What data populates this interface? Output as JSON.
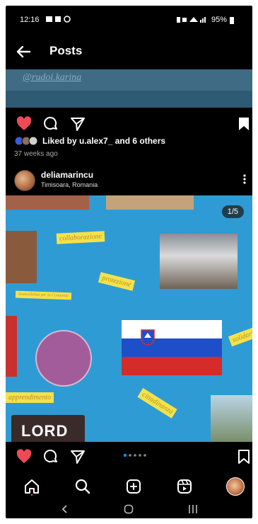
{
  "status_bar": {
    "time": "12:16",
    "battery": "95%"
  },
  "header": {
    "title": "Posts"
  },
  "prev_post": {
    "caption_text": "@rudoi.karina",
    "liked_by": "Liked by u.alex7_ and 6 others",
    "time_ago": "37 weeks ago"
  },
  "post": {
    "username": "deliamarincu",
    "location": "Timisoara, Romania",
    "counter": "1/5",
    "tags": [
      "collaborazione",
      "protezione",
      "Sostenibilità per la Comunità",
      "apprendimento",
      "cittadinanza",
      "solidarietà"
    ],
    "poster_text": "LORD"
  },
  "colors": {
    "background": "#000000",
    "like": "#ed4956",
    "photo_bg": "#2f9bd4",
    "accent": "#0095f6"
  },
  "icons": [
    "back-arrow-icon",
    "heart-icon",
    "comment-icon",
    "share-icon",
    "bookmark-icon",
    "more-icon",
    "home-icon",
    "search-icon",
    "create-icon",
    "reels-icon",
    "profile-icon",
    "nav-back-icon",
    "nav-home-icon",
    "nav-recents-icon"
  ]
}
